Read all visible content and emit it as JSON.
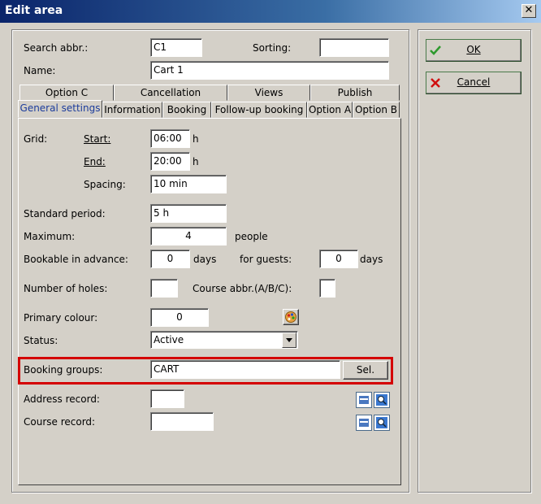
{
  "window": {
    "title": "Edit area",
    "close_symbol": "✕"
  },
  "header": {
    "search_abbr_label": "Search abbr.:",
    "search_abbr_value": "C1",
    "sorting_label": "Sorting:",
    "sorting_value": "",
    "name_label": "Name:",
    "name_value": "Cart 1"
  },
  "tabs": {
    "row1": [
      "Option C",
      "Cancellation",
      "Views",
      "Publish"
    ],
    "row2": [
      "General settings",
      "Information",
      "Booking",
      "Follow-up booking",
      "Option A",
      "Option B"
    ]
  },
  "general": {
    "grid_label": "Grid:",
    "start_label": "Start:",
    "start_value": "06:00",
    "start_unit": "h",
    "end_label": "End:",
    "end_value": "20:00",
    "end_unit": "h",
    "spacing_label": "Spacing:",
    "spacing_value": "10 min",
    "standard_period_label": "Standard period:",
    "standard_period_value": "5 h",
    "maximum_label": "Maximum:",
    "maximum_value": "4",
    "maximum_unit": "people",
    "bookable_label": "Bookable in advance:",
    "bookable_value": "0",
    "bookable_unit": "days",
    "guests_label": "for guests:",
    "guests_value": "0",
    "guests_unit": "days",
    "holes_label": "Number of holes:",
    "holes_value": "",
    "course_abbr_label": "Course abbr.(A/B/C):",
    "course_abbr_value": "",
    "primary_colour_label": "Primary colour:",
    "primary_colour_value": "0",
    "status_label": "Status:",
    "status_value": "Active",
    "booking_groups_label": "Booking groups:",
    "booking_groups_value": "CART",
    "sel_label": "Sel.",
    "address_record_label": "Address record:",
    "address_record_value": "",
    "course_record_label": "Course record:",
    "course_record_value": ""
  },
  "actions": {
    "ok_label": "OK",
    "cancel_label": "Cancel"
  },
  "colors": {
    "highlight": "#d40000",
    "ok_check": "#2e9a2e",
    "cancel_x": "#d01010",
    "active_tab": "#1c3c9c"
  }
}
